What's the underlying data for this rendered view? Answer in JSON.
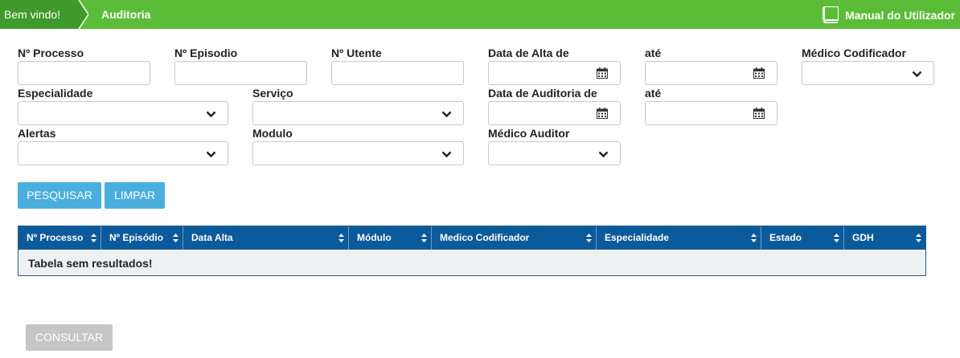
{
  "breadcrumb": {
    "home": "Bem vindo!",
    "current": "Auditoria"
  },
  "manual": {
    "label": "Manual do Utilizador",
    "icon": "book-icon"
  },
  "form": {
    "n_processo": "Nº Processo",
    "n_episodio": "Nº Episodio",
    "n_utente": "Nº Utente",
    "data_alta_de": "Data de Alta de",
    "ate1": "até",
    "medico_codificador": "Médico Codificador",
    "especialidade": "Especialidade",
    "servico": "Serviço",
    "data_auditoria_de": "Data de Auditoria de",
    "ate2": "até",
    "alertas": "Alertas",
    "modulo": "Modulo",
    "medico_auditor": "Médico Auditor"
  },
  "buttons": {
    "pesquisar": "PESQUISAR",
    "limpar": "LIMPAR",
    "consultar": "CONSULTAR"
  },
  "table": {
    "columns": [
      "Nº Processo",
      "Nº Episódio",
      "Data Alta",
      "Módulo",
      "Medico Codificador",
      "Especialidade",
      "Estado",
      "GDH"
    ],
    "empty_message": "Tabela sem resultados!"
  },
  "colors": {
    "topbar": "#5bbd37",
    "breadcrumb_home": "#3f9a2b",
    "table_header": "#0b5a9b",
    "button_primary": "#4aaedf",
    "button_disabled": "#c6c6c6"
  }
}
